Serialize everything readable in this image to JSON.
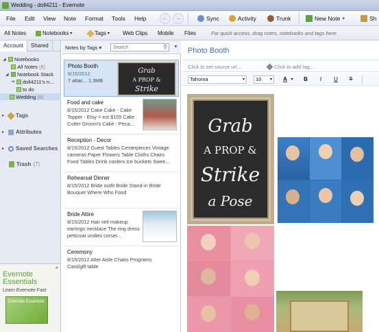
{
  "window": {
    "title": "Wedding - doll4211 - Evernote"
  },
  "menu": [
    "File",
    "Edit",
    "View",
    "Note",
    "Format",
    "Tools",
    "Help"
  ],
  "toolbar": {
    "sync": "Sync",
    "activity": "Activity",
    "trunk": "Trunk",
    "new_note": "New Note",
    "share": "Sh"
  },
  "linkbar": {
    "items": [
      "All Notes",
      "Notebooks",
      "Tags",
      "Web Clips",
      "Mobile",
      "Files"
    ],
    "hint": "For quick access, drag notes, notebooks and tags here"
  },
  "sidebar": {
    "tabs": [
      "Account",
      "Shared"
    ],
    "notebooks_header": "Notebooks",
    "all_notes": {
      "label": "All Notes",
      "count": "(6)"
    },
    "stack": "Notebook Stack",
    "stack_item_1": "doll4211's n...",
    "stack_item_2": "to do",
    "wedding": {
      "label": "Wedding",
      "count": "(6)"
    },
    "tags": "Tags",
    "attributes": "Attributes",
    "saved_searches": "Saved Searches",
    "trash": {
      "label": "Trash",
      "count": "(7)"
    }
  },
  "promo": {
    "brand_line1": "Evernote",
    "brand_line2": "Essentials",
    "tagline": "Learn Evernote Fast",
    "book_label": "Evernote Essentials",
    "close": "×"
  },
  "note_list": {
    "sort_label": "Notes by Tags",
    "search_placeholder": "Search",
    "notes": [
      {
        "title": "Photo Booth",
        "date": "8/15/2012",
        "line2": "7 attac... 1.3MB",
        "line3": ""
      },
      {
        "title": "Food and cake",
        "date": "8/15/2012",
        "line2": "8/15/2012 Cake Cake - Cake Topper - Etsy = est $155 Cake Cutter Groom's Cake - Peca..."
      },
      {
        "title": "Reception - Decor",
        "date": "8/15/2012",
        "line2": "8/15/2012 Guest Tables Centerpieces Vintage cameras Paper Flowers Table Cloths Chairs Food Tables Drink coolers Ice buckets Swee..."
      },
      {
        "title": "Rehearsal Dinner",
        "date": "",
        "line2": "8/15/2012 Bride outfit Bride Stand-in Bride Bouquet Where Who Food"
      },
      {
        "title": "Bride Attire",
        "date": "8/15/2012",
        "line2": "8/15/2012 Hair veil makeup earrings necklace The ring dress petticoat undies corset..."
      },
      {
        "title": "Ceremony",
        "date": "",
        "line2": "8/15/2012 Alter Aisle Chairs Programs Card/gift table"
      }
    ]
  },
  "editor": {
    "title": "Photo Booth",
    "source_placeholder": "Click to set source url...",
    "tags_placeholder": "Click to add tag...",
    "font": "Tahoma",
    "size": "10",
    "chalkboard_text": [
      "Grab",
      "A PROP &",
      "Strike",
      "a Pose"
    ]
  },
  "colors": {
    "accent": "#3b6fbf",
    "evernote_green": "#5aa23a"
  }
}
